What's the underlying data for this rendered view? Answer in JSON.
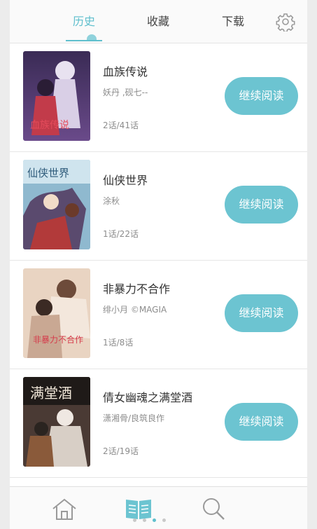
{
  "tabs": [
    {
      "label": "历史",
      "active": true
    },
    {
      "label": "收藏",
      "active": false
    },
    {
      "label": "下载",
      "active": false
    }
  ],
  "icons": {
    "settings": "gear-icon",
    "home": "home-icon",
    "bookshelf": "bookshelf-icon",
    "search": "search-icon"
  },
  "colors": {
    "accent": "#5fbfcd",
    "button": "#6cc4d1"
  },
  "items": [
    {
      "title": "血族传说",
      "author": "妖丹 ,砚七--",
      "progress": "2话/41话",
      "action": "继续阅读"
    },
    {
      "title": "仙侠世界",
      "author": "涂秋",
      "progress": "1话/22话",
      "action": "继续阅读"
    },
    {
      "title": "非暴力不合作",
      "author": "绯小月 ©MAGIA",
      "progress": "1话/8话",
      "action": "继续阅读"
    },
    {
      "title": "倩女幽魂之满堂酒",
      "author": "潇湘骨/良筑良作",
      "progress": "2话/19话",
      "action": "继续阅读"
    }
  ],
  "pager": {
    "count": 4,
    "current": 2
  }
}
